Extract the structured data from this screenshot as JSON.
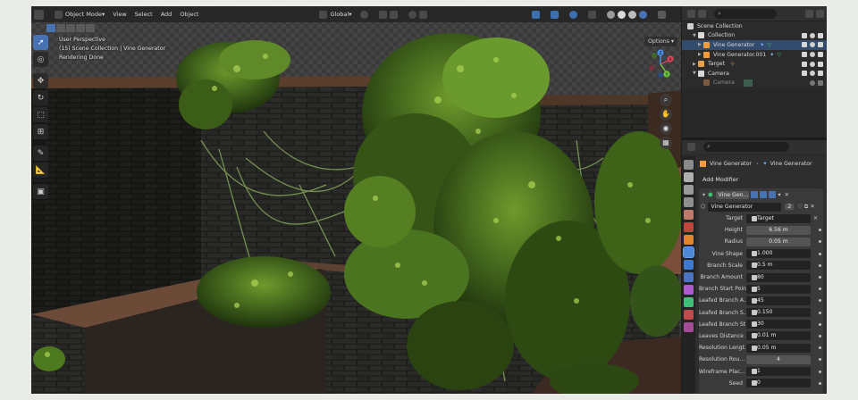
{
  "colors": {
    "accent": "#4772b3",
    "selected_row": "#334c6e",
    "modifier_icon": "#7fb0ff",
    "node_icon": "#3fbf77"
  },
  "viewport": {
    "menu": [
      "Object Mode",
      "View",
      "Select",
      "Add",
      "Object"
    ],
    "transform": "Global",
    "info_lines": [
      "User Perspective",
      "(15) Scene Collection | Vine Generator",
      "Rendering Done"
    ],
    "options_label": "Options",
    "gizmo_axes": [
      "X",
      "Y",
      "Z"
    ]
  },
  "outliner": {
    "rows": [
      {
        "label": "Scene Collection",
        "indent": 0,
        "icon": "collection-icon"
      },
      {
        "label": "Collection",
        "indent": 1,
        "icon": "collection-icon"
      },
      {
        "label": "Vine Generator",
        "indent": 2,
        "icon": "mesh-icon"
      },
      {
        "label": "Vine Generator.001",
        "indent": 2,
        "icon": "mesh-icon"
      },
      {
        "label": "Target",
        "indent": 1,
        "icon": "empty-icon"
      },
      {
        "label": "Camera",
        "indent": 1,
        "icon": "camera-icon"
      },
      {
        "label": "Camera",
        "indent": 2,
        "icon": "camera-data-icon"
      }
    ]
  },
  "properties": {
    "breadcrumb": [
      "Vine Generator",
      "Vine Generator"
    ],
    "add_modifier": "Add Modifier",
    "modifier_name": "Vine Gen...",
    "node_group": "Vine Generator",
    "node_users": "2",
    "fields": [
      {
        "label": "Target",
        "value": "Target",
        "kind": "object"
      },
      {
        "label": "Height",
        "value": "6.56 m"
      },
      {
        "label": "Radius",
        "value": "0.05 m"
      },
      {
        "label": "Vine Shape",
        "value": "1.000"
      },
      {
        "label": "Branch Scale",
        "value": "0.5 m"
      },
      {
        "label": "Branch Amount",
        "value": "80"
      },
      {
        "label": "Branch Start Point",
        "value": "5"
      },
      {
        "label": "Leafed Branch A...",
        "value": "45"
      },
      {
        "label": "Leafed Branch S...",
        "value": "0.150"
      },
      {
        "label": "Leafed Branch St",
        "value": "30"
      },
      {
        "label": "Leaves Distance ...",
        "value": "0.01 m"
      },
      {
        "label": "Resolution Lengt...",
        "value": "0.05 m"
      },
      {
        "label": "Resolution Rou...",
        "value": "4"
      },
      {
        "label": "Wireframe Plac...",
        "value": "1"
      },
      {
        "label": "Seed",
        "value": "0"
      }
    ]
  }
}
